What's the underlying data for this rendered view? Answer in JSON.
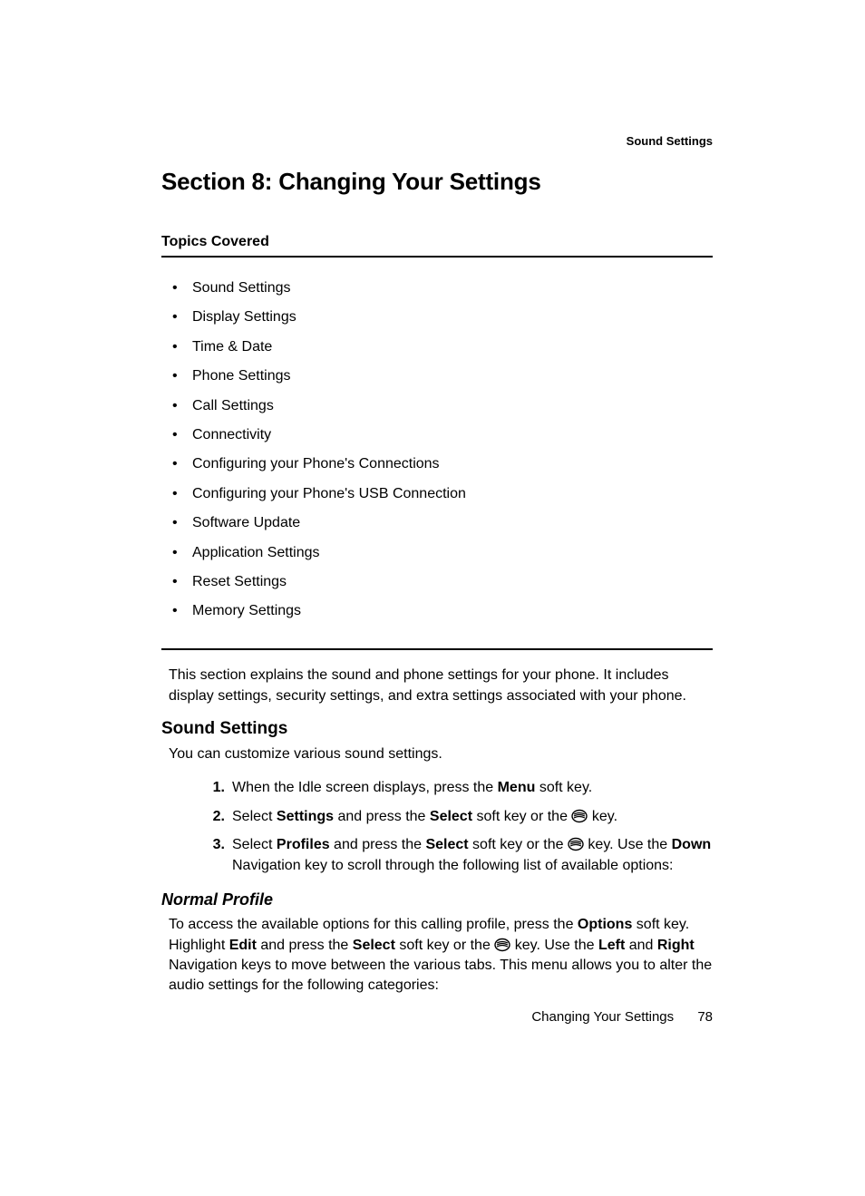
{
  "runningHead": "Sound Settings",
  "sectionTitle": "Section 8: Changing Your Settings",
  "topicsLabel": "Topics Covered",
  "topics": [
    "Sound Settings",
    "Display Settings",
    "Time & Date",
    "Phone Settings",
    "Call Settings",
    "Connectivity",
    "Configuring your Phone's Connections",
    "Configuring your Phone's USB Connection",
    "Software Update",
    "Application Settings",
    "Reset Settings",
    "Memory Settings"
  ],
  "intro": "This section explains the sound and phone settings for your phone. It includes display settings, security settings, and extra settings associated with your phone.",
  "soundSettings": {
    "heading": "Sound Settings",
    "lead": "You can customize various sound settings.",
    "step1": {
      "pre": "When the Idle screen displays, press the ",
      "b1": "Menu",
      "post": " soft key."
    },
    "step2": {
      "t1": "Select ",
      "b1": "Settings",
      "t2": " and press the ",
      "b2": "Select",
      "t3": " soft key or the ",
      "t4": " key."
    },
    "step3": {
      "t1": "Select ",
      "b1": "Profiles",
      "t2": " and press the ",
      "b2": "Select",
      "t3": " soft key or the ",
      "t4": " key. Use the ",
      "b3": "Down",
      "t5": " Navigation key to scroll through the following list of available options:"
    }
  },
  "normalProfile": {
    "heading": "Normal Profile",
    "p": {
      "t1": "To access the available options for this calling profile, press the ",
      "b1": "Options",
      "t2": " soft key. Highlight ",
      "b2": "Edit",
      "t3": " and press the ",
      "b3": "Select",
      "t4": " soft key or the ",
      "t5": " key. Use the ",
      "b4": "Left",
      "t6": " and ",
      "b5": "Right",
      "t7": " Navigation keys to move between the various tabs. This menu allows you to alter the audio settings for the following categories:"
    }
  },
  "footer": {
    "label": "Changing Your Settings",
    "page": "78"
  }
}
